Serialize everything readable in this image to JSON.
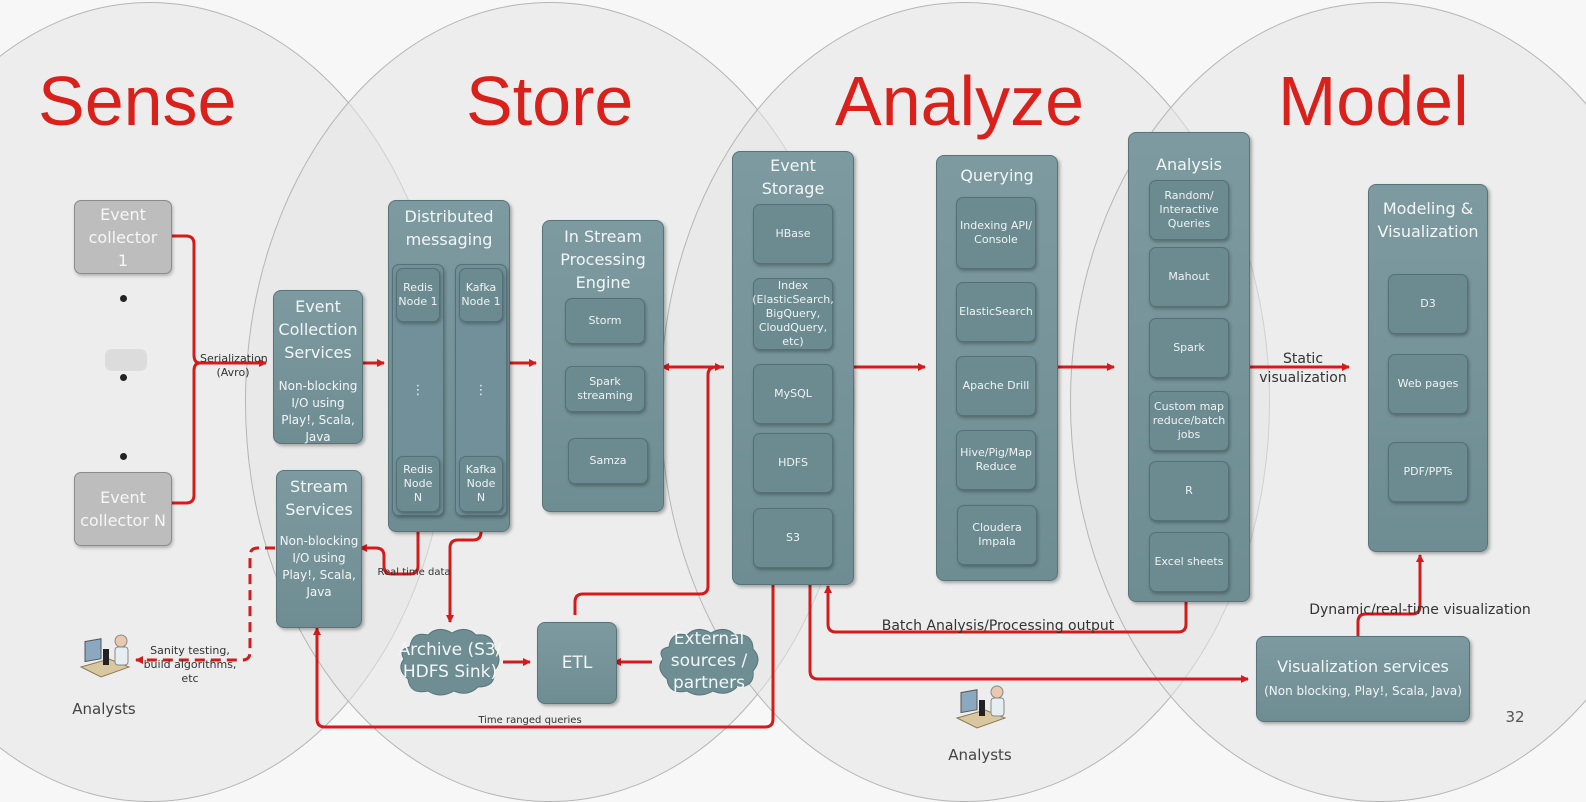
{
  "phases": [
    "Sense",
    "Store",
    "Analyze",
    "Model"
  ],
  "sense": {
    "collector_1": "Event collector 1",
    "collector_n": "Event collector N",
    "serialization_label": "Serialization (Avro)",
    "analysts_label": "Analysts",
    "sanity_label": "Sanity testing, build algorithms, etc"
  },
  "event_collection": {
    "title": "Event Collection Services",
    "subtitle": "Non-blocking I/O using Play!, Scala, Java"
  },
  "stream_services": {
    "title": "Stream Services",
    "subtitle": "Non-blocking I/O using Play!, Scala, Java"
  },
  "distributed_messaging": {
    "title": "Distributed messaging",
    "redis_1": "Redis Node 1",
    "redis_n": "Redis Node N",
    "kafka_1": "Kafka Node 1",
    "kafka_n": "Kafka Node N",
    "ellipsis": "⋮"
  },
  "in_stream": {
    "title": "In Stream Processing Engine",
    "items": [
      "Storm",
      "Spark streaming",
      "Samza"
    ]
  },
  "real_time_label": "Real time data",
  "archive": "Archive (S3/ HDFS Sink)",
  "etl": "ETL",
  "external_sources": "External sources / partners",
  "time_ranged_label": "Time ranged queries",
  "event_storage": {
    "title": "Event Storage",
    "items": [
      "HBase",
      "Index (ElasticSearch, BigQuery, CloudQuery, etc)",
      "MySQL",
      "HDFS",
      "S3"
    ]
  },
  "querying": {
    "title": "Querying",
    "items": [
      "Indexing API/ Console",
      "ElasticSearch",
      "Apache Drill",
      "Hive/Pig/Map Reduce",
      "Cloudera Impala"
    ]
  },
  "analysis": {
    "title": "Analysis",
    "items": [
      "Random/ Interactive Queries",
      "Mahout",
      "Spark",
      "Custom map reduce/batch jobs",
      "R",
      "Excel sheets"
    ]
  },
  "batch_label": "Batch Analysis/Processing output",
  "static_viz_label": "Static visualization",
  "modeling": {
    "title": "Modeling & Visualization",
    "items": [
      "D3",
      "Web pages",
      "PDF/PPTs"
    ]
  },
  "dynamic_label": "Dynamic/real-time visualization",
  "viz_services": {
    "title": "Visualization services",
    "subtitle": "(Non blocking, Play!, Scala, Java)"
  },
  "analysts_bottom_label": "Analysts",
  "page_number": "32",
  "colors": {
    "phase_title": "#d9201b",
    "arrow": "#d41a1a",
    "box": "#7592a0"
  }
}
